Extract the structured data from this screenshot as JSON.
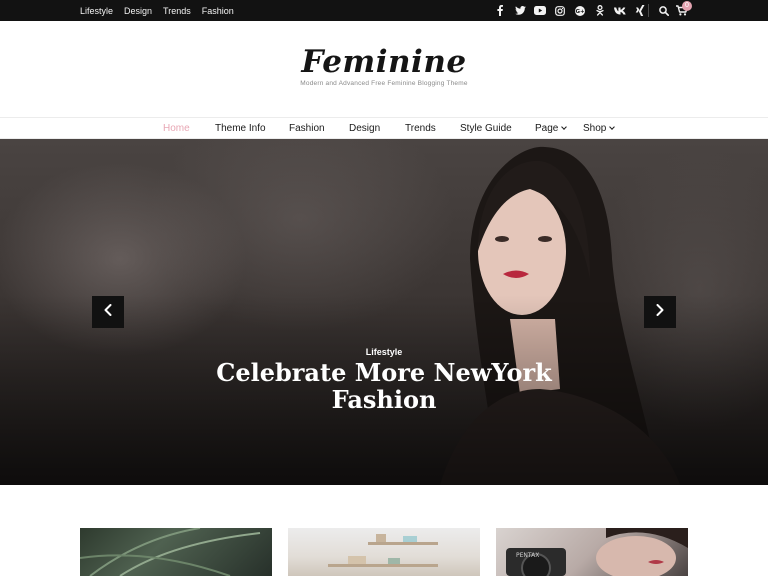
{
  "topbar": {
    "links": [
      "Lifestyle",
      "Design",
      "Trends",
      "Fashion"
    ],
    "social_icons": [
      "facebook-icon",
      "twitter-icon",
      "youtube-icon",
      "instagram-icon",
      "google-plus-icon",
      "odnoklassniki-icon",
      "vk-icon",
      "xing-icon"
    ],
    "cart_count": "0"
  },
  "header": {
    "site_title": "Feminine",
    "tagline": "Modern and Advanced Free Feminine Blogging Theme"
  },
  "nav": {
    "items": [
      "Home",
      "Theme Info",
      "Fashion",
      "Design",
      "Trends",
      "Style Guide",
      "Page",
      "Shop"
    ],
    "active_index": 0
  },
  "hero": {
    "category": "Lifestyle",
    "title": "Celebrate More NewYork Fashion",
    "prev_icon": "chevron-left-icon",
    "next_icon": "chevron-right-icon"
  },
  "colors": {
    "topbar_bg": "#121212",
    "accent": "#e8a7b4"
  }
}
